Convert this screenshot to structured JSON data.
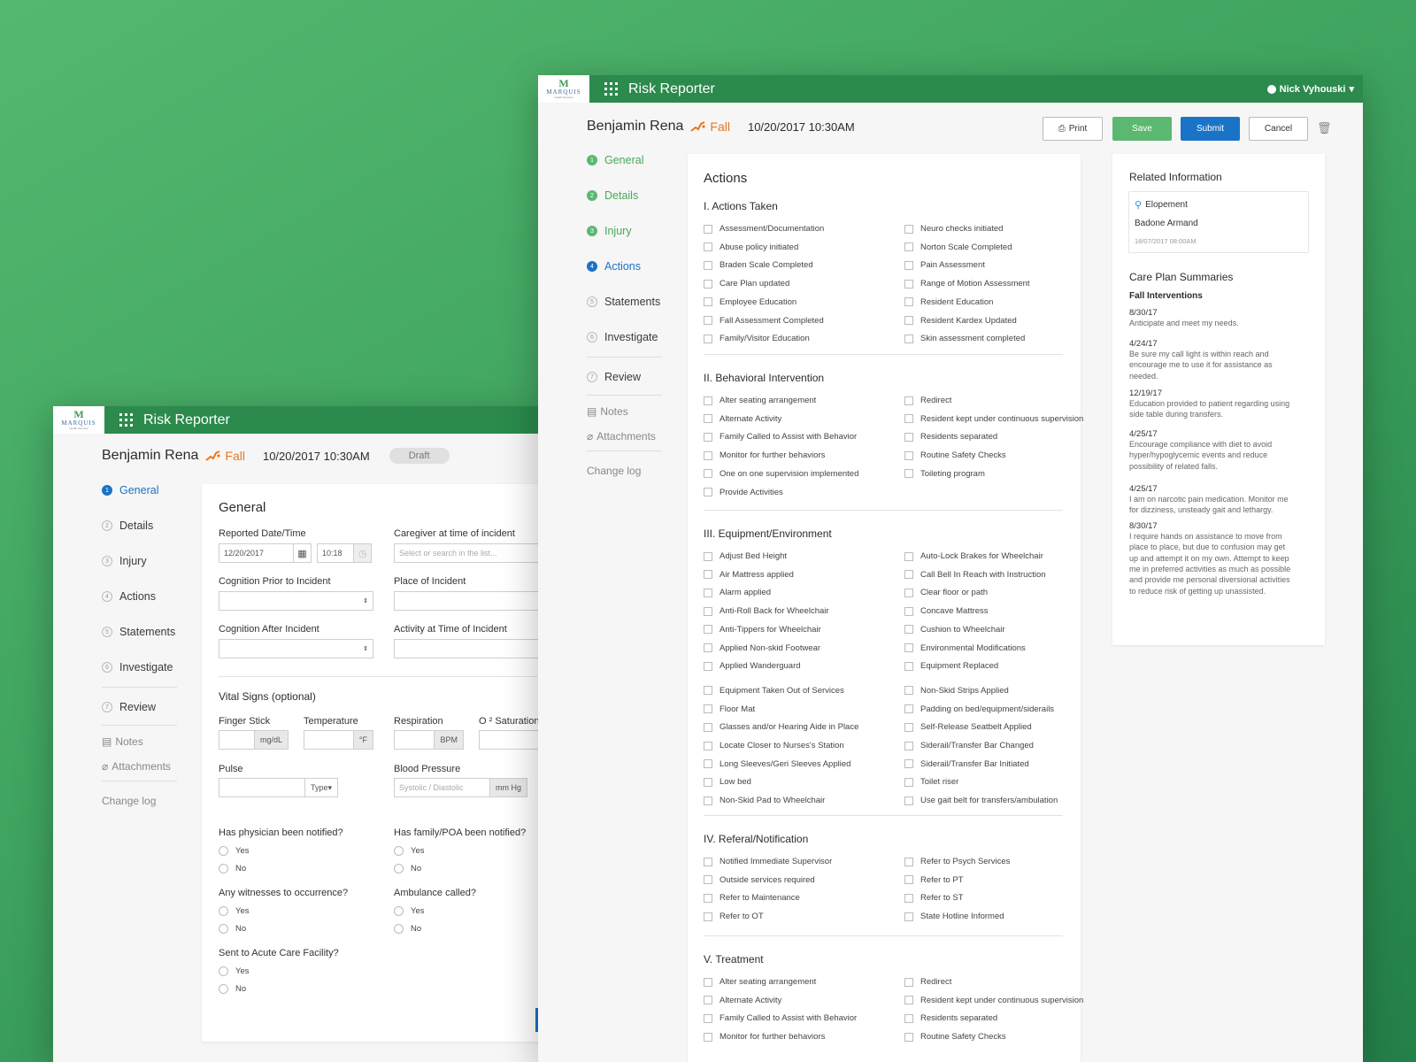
{
  "app_title": "Risk Reporter",
  "logo": {
    "mark": "M",
    "name": "MARQUIS",
    "sub": "Health Services"
  },
  "window_back": {
    "patient": "Benjamin Rena",
    "event": "Fall",
    "datetime": "10/20/2017 10:30AM",
    "status": "Draft",
    "nav": [
      "General",
      "Details",
      "Injury",
      "Actions",
      "Statements",
      "Investigate",
      "Review"
    ],
    "nav_nums": [
      "1",
      "2",
      "3",
      "4",
      "5",
      "6",
      "7"
    ],
    "nav_extra": {
      "notes": "Notes",
      "attachments": "Attachments",
      "changelog": "Change log"
    },
    "form": {
      "title": "General",
      "reported_label": "Reported Date/Time",
      "reported_date": "12/20/2017",
      "reported_time": "10:18",
      "caregiver_label": "Caregiver at time of incident",
      "caregiver_placeholder": "Select or search in the list...",
      "cognition_prior": "Cognition Prior to Incident",
      "place": "Place of Incident",
      "cognition_after": "Cognition After Incident",
      "activity": "Activity at Time of Incident",
      "vitals_title": "Vital Signs (optional)",
      "finger_stick": "Finger Stick",
      "finger_unit": "mg/dL",
      "temperature": "Temperature",
      "temp_unit": "°F",
      "respiration": "Respiration",
      "resp_unit": "BPM",
      "o2": "O ² Saturation",
      "pulse": "Pulse",
      "pulse_type": "Type",
      "bp": "Blood Pressure",
      "bp_placeholder": "Systolic / Diastolic",
      "bp_unit": "mm Hg",
      "q_physician": "Has physician been notified?",
      "q_family": "Has family/POA been notified?",
      "q_witness": "Any witnesses to occurrence?",
      "q_ambulance": "Ambulance called?",
      "q_acute": "Sent to Acute Care Facility?",
      "yes": "Yes",
      "no": "No"
    }
  },
  "window_front": {
    "patient": "Benjamin Rena",
    "event": "Fall",
    "datetime": "10/20/2017 10:30AM",
    "user": "Nick Vyhouski",
    "buttons": {
      "print": "Print",
      "save": "Save",
      "submit": "Submit",
      "cancel": "Cancel"
    },
    "nav": [
      "General",
      "Details",
      "Injury",
      "Actions",
      "Statements",
      "Investigate",
      "Review"
    ],
    "nav_nums": [
      "1",
      "2",
      "3",
      "4",
      "5",
      "6",
      "7"
    ],
    "nav_extra": {
      "notes": "Notes",
      "attachments": "Attachments",
      "changelog": "Change log"
    },
    "actions": {
      "title": "Actions",
      "sections": [
        {
          "title": "I. Actions Taken",
          "left": [
            "Assessment/Documentation",
            "Abuse policy initiated",
            "Braden Scale Completed",
            "Care Plan updated",
            "Employee Education",
            "Fall Assessment Completed",
            "Family/Visitor Education"
          ],
          "right": [
            "Neuro checks initiated",
            "Norton Scale Completed",
            "Pain Assessment",
            "Range of Motion Assessment",
            "Resident Education",
            "Resident Kardex Updated",
            "Skin assessment completed"
          ]
        },
        {
          "title": "II. Behavioral Intervention",
          "left": [
            "Alter seating arrangement",
            "Alternate Activity",
            "Family Called to Assist with Behavior",
            "Monitor for further behaviors",
            "One on one supervision implemented",
            "Provide Activities"
          ],
          "right": [
            "Redirect",
            "Resident kept under continuous supervision",
            "Residents separated",
            "Routine Safety Checks",
            "Toileting program"
          ]
        },
        {
          "title": "III. Equipment/Environment",
          "left": [
            "Adjust Bed Height",
            "Air Mattress applied",
            "Alarm applied",
            "Anti-Roll Back for Wheelchair",
            "Anti-Tippers for Wheelchair",
            "Applied Non-skid Footwear",
            "Applied Wanderguard",
            "Equipment Taken Out of Services",
            "Floor Mat",
            "Glasses and/or Hearing Aide in Place",
            "Locate Closer to Nurses's Station",
            "Long Sleeves/Geri Sleeves Applied",
            "Low bed",
            "Non-Skid Pad to Wheelchair"
          ],
          "right": [
            "Auto-Lock Brakes for Wheelchair",
            "Call Bell In Reach with Instruction",
            "Clear floor or path",
            "Concave Mattress",
            "Cushion to Wheelchair",
            "Environmental Modifications",
            "Equipment Replaced",
            "Non-Skid Strips Applied",
            "Padding on bed/equipment/siderails",
            "Self-Release Seatbelt Applied",
            "Siderail/Transfer Bar Changed",
            "Siderail/Transfer Bar Initiated",
            "Toilet riser",
            "Use gait belt for transfers/ambulation"
          ]
        },
        {
          "title": "IV. Referal/Notification",
          "left": [
            "Notified Immediate Supervisor",
            "Outside services required",
            "Refer to Maintenance",
            "Refer to OT"
          ],
          "right": [
            "Refer to Psych Services",
            "Refer to PT",
            "Refer to ST",
            "State Hotline Informed"
          ]
        },
        {
          "title": "V. Treatment",
          "left": [
            "Alter seating arrangement",
            "Alternate Activity",
            "Family Called to Assist with Behavior",
            "Monitor for further behaviors"
          ],
          "right": [
            "Redirect",
            "Resident kept under continuous supervision",
            "Residents separated",
            "Routine Safety Checks"
          ]
        }
      ]
    },
    "related": {
      "title": "Related Information",
      "item_type": "Elopement",
      "item_name": "Badone Armand",
      "item_date": "18/07/2017 08:00AM",
      "care_title": "Care Plan Summaries",
      "care_sub": "Fall Interventions",
      "entries": [
        {
          "date": "8/30/17",
          "text": [
            "Anticipate and meet my needs."
          ]
        },
        {
          "date": "4/24/17",
          "text": [
            "Be sure my call light is within reach and",
            "encourage me to use it for assistance as",
            "needed."
          ]
        },
        {
          "date": "12/19/17",
          "text": [
            "Education provided to patient regarding using",
            "side table during transfers."
          ]
        },
        {
          "date": "4/25/17",
          "text": [
            "Encourage compliance with diet to avoid",
            "hyper/hypoglycemic events and reduce",
            "possibility of related falls."
          ]
        },
        {
          "date": "4/25/17",
          "text": [
            "I am on narcotic pain medication. Monitor me",
            "for dizziness, unsteady gait and lethargy."
          ]
        },
        {
          "date": "8/30/17",
          "text": [
            "I require hands on assistance to move from",
            "place to place, but due to confusion may get",
            "up and attempt it on my own. Attempt to keep",
            "me in preferred activities as much as possible",
            "and provide me personal diversional activities",
            "to reduce risk of getting up unassisted."
          ]
        }
      ]
    }
  }
}
